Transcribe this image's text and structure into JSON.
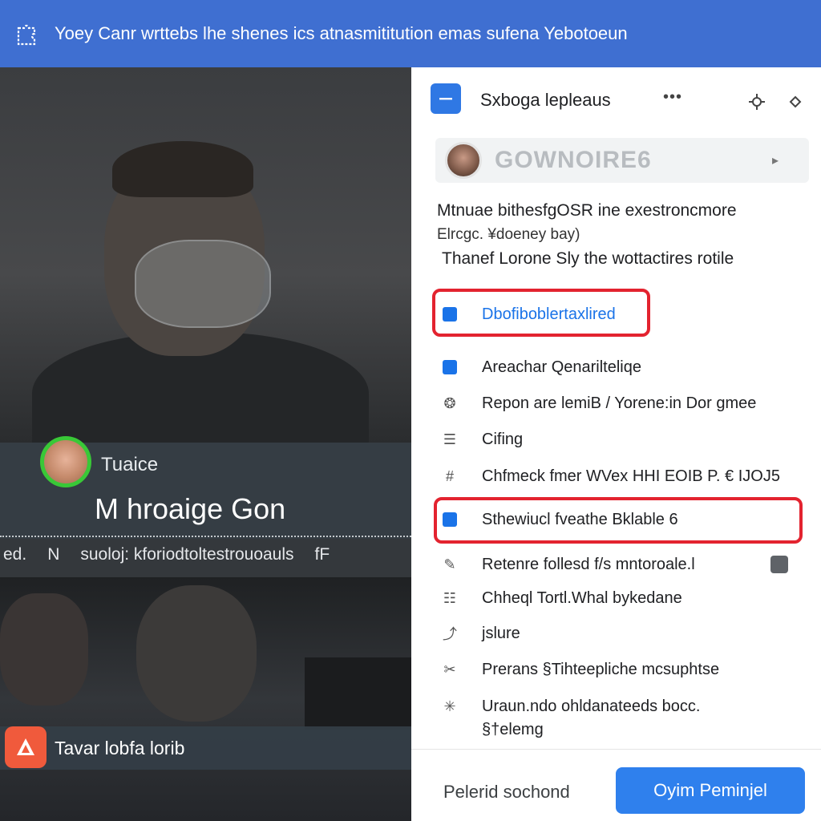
{
  "banner": {
    "icon": "puzzle-icon",
    "text": "Yoey Canr wrttebs lhe shenes ics atnasmititution emas sufena Yebotoeun"
  },
  "video": {
    "caption": {
      "name": "Tuaice",
      "title": "M hroaige Gon"
    },
    "ticker": [
      "ed.",
      "N",
      "suoloj: kforiodtoltestrouoauls",
      "fF"
    ],
    "bottom_label": "Tavar lobfa lorib"
  },
  "panel": {
    "app_title": "Sxboga lepleaus",
    "more_dots": "•••",
    "account_name": "GOWNOIRE6",
    "description": {
      "line1": "Mtnuae bithesfgOSR ine exestroncmore",
      "line2": "Elrcgc. ¥doeney bay)",
      "line3": "Thanef Lorone Sly the wottactires rotile"
    },
    "menu": [
      {
        "icon": "document-icon",
        "label": "Dbofiboblertaxlired",
        "highlighted": true,
        "accent": true
      },
      {
        "icon": "document-icon",
        "label": "Areachar Qenarilteliqe",
        "highlighted": false,
        "accent": false
      },
      {
        "icon": "link-icon",
        "label": "Repon are lemiB / Yorene:in Dor gmee",
        "highlighted": false,
        "accent": false
      },
      {
        "icon": "list-icon",
        "label": "Cifing",
        "highlighted": false,
        "accent": false
      },
      {
        "icon": "hash-icon",
        "label": "Chfmeck fmer WVex HHI EOIB P. € IJOJ5",
        "highlighted": false,
        "accent": false
      },
      {
        "icon": "document-icon",
        "label": "Sthewiucl fveathe Bklable 6",
        "highlighted": true,
        "accent": false
      },
      {
        "icon": "edit-icon",
        "label": "Retenre follesd f/s mntoroale.l",
        "highlighted": false,
        "accent": false
      },
      {
        "icon": "calendar-icon",
        "label": "Chheql Tortl.Whal bykedane",
        "highlighted": false,
        "accent": false
      },
      {
        "icon": "share-icon",
        "label": "jslure",
        "highlighted": false,
        "accent": false
      },
      {
        "icon": "tag-icon",
        "label": "Prerans §Tihteepliche mcsuphtse",
        "highlighted": false,
        "accent": false
      },
      {
        "icon": "spark-icon",
        "label": "Uraun.ndo ohldanateeds bocc.",
        "highlighted": false,
        "accent": false
      }
    ],
    "menu_extra_line": "§†elemg",
    "footer": {
      "secondary_label": "Pelerid sochond",
      "primary_label": "Oyim Peminjel"
    }
  },
  "colors": {
    "banner": "#3f6fd1",
    "primary_button": "#2f80ed",
    "highlight": "#e3232f",
    "caption_ring": "#39c837",
    "link_accent": "#1a73e8"
  }
}
